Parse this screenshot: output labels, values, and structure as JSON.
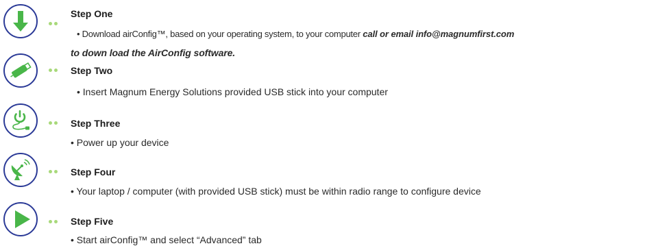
{
  "colors": {
    "icon_border": "#2b3a97",
    "icon_green": "#49b649",
    "dot_green": "#a8d97a",
    "text": "#2a2a2a"
  },
  "steps": [
    {
      "icon": "download-arrow-icon",
      "title": "Step One",
      "body_prefix": "•  Download airConfig™, based on your operating system, to your computer ",
      "body_emphasis_1": "call or email info@magnumfirst.com",
      "body_emphasis_2": "to down load the AirConfig software."
    },
    {
      "icon": "usb-stick-icon",
      "title": "Step Two",
      "body": "•  Insert Magnum Energy Solutions provided USB stick into your computer"
    },
    {
      "icon": "power-plug-icon",
      "title": "Step Three",
      "body": "• Power up your device"
    },
    {
      "icon": "satellite-dish-icon",
      "title": "Step Four",
      "body": "• Your laptop / computer (with provided USB stick) must be within radio range to configure device"
    },
    {
      "icon": "play-icon",
      "title": "Step Five",
      "body": "• Start airConfig™ and select  “Advanced” tab"
    }
  ]
}
